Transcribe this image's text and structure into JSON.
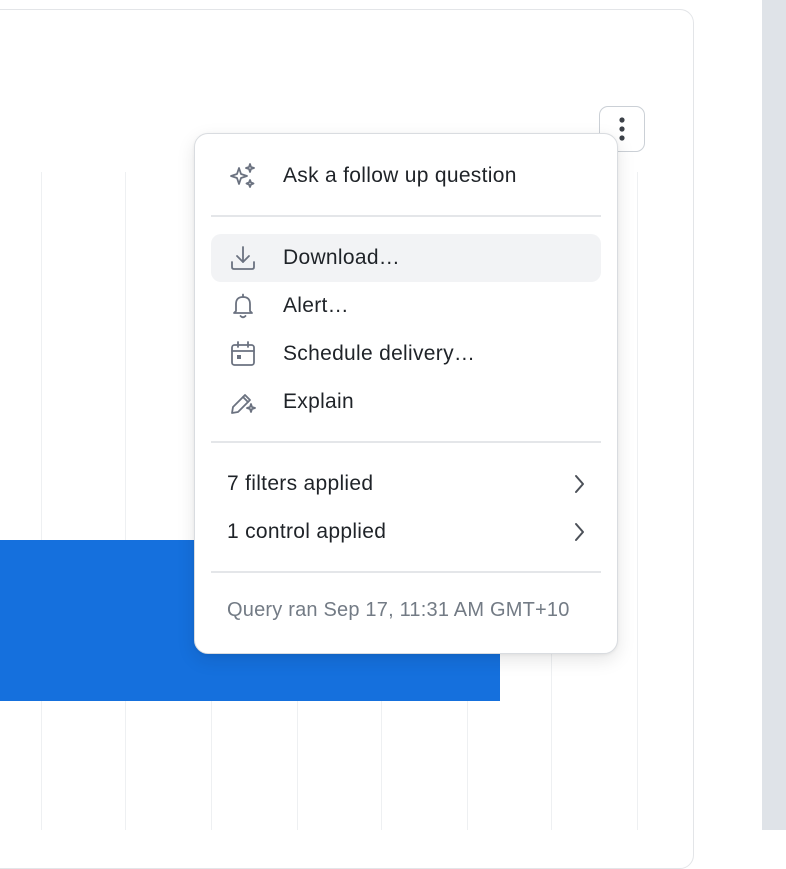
{
  "menu": {
    "ask": {
      "label": "Ask a follow up question",
      "icon": "sparkles-icon"
    },
    "actions": [
      {
        "label": "Download…",
        "icon": "download-icon",
        "highlighted": true
      },
      {
        "label": "Alert…",
        "icon": "bell-icon"
      },
      {
        "label": "Schedule delivery…",
        "icon": "calendar-icon"
      },
      {
        "label": "Explain",
        "icon": "pencil-sparkle-icon"
      }
    ],
    "submenus": [
      {
        "label": "7 filters applied",
        "icon": "chevron-right-icon"
      },
      {
        "label": "1 control applied",
        "icon": "chevron-right-icon"
      }
    ],
    "footer": "Query ran Sep 17, 11:31 AM GMT+10"
  },
  "colors": {
    "bar": "#1570dd",
    "highlight": "#f2f3f5",
    "icon": "#6b7280",
    "text": "#1f2328",
    "muted": "#737b85"
  }
}
